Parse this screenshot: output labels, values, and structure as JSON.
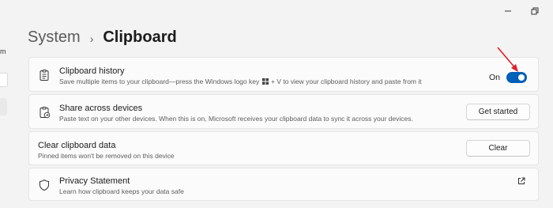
{
  "breadcrumb": {
    "parent": "System",
    "separator": "›",
    "current": "Clipboard"
  },
  "left_nav": {
    "fragment": "m"
  },
  "clipboard_history": {
    "title": "Clipboard history",
    "desc_before": "Save multiple items to your clipboard—press the Windows logo key",
    "desc_after": "+ V to view your clipboard history and paste from it",
    "toggle_label": "On",
    "toggle_state": "on"
  },
  "share_across_devices": {
    "title": "Share across devices",
    "desc": "Paste text on your other devices. When this is on, Microsoft receives your clipboard data to sync it across your devices.",
    "button_label": "Get started"
  },
  "clear_data": {
    "title": "Clear clipboard data",
    "desc": "Pinned items won't be removed on this device",
    "button_label": "Clear"
  },
  "privacy": {
    "title": "Privacy Statement",
    "desc": "Learn how clipboard keeps your data safe"
  },
  "icons": [
    "minimize-icon",
    "restore-icon",
    "clipboard-icon",
    "clipboard-share-icon",
    "windows-logo-icon",
    "shield-icon",
    "external-link-icon",
    "annotation-arrow-icon"
  ],
  "colors": {
    "accent": "#005fb8",
    "annotation": "#e0202a",
    "background": "#f3f3f3",
    "card": "#fbfbfb"
  }
}
